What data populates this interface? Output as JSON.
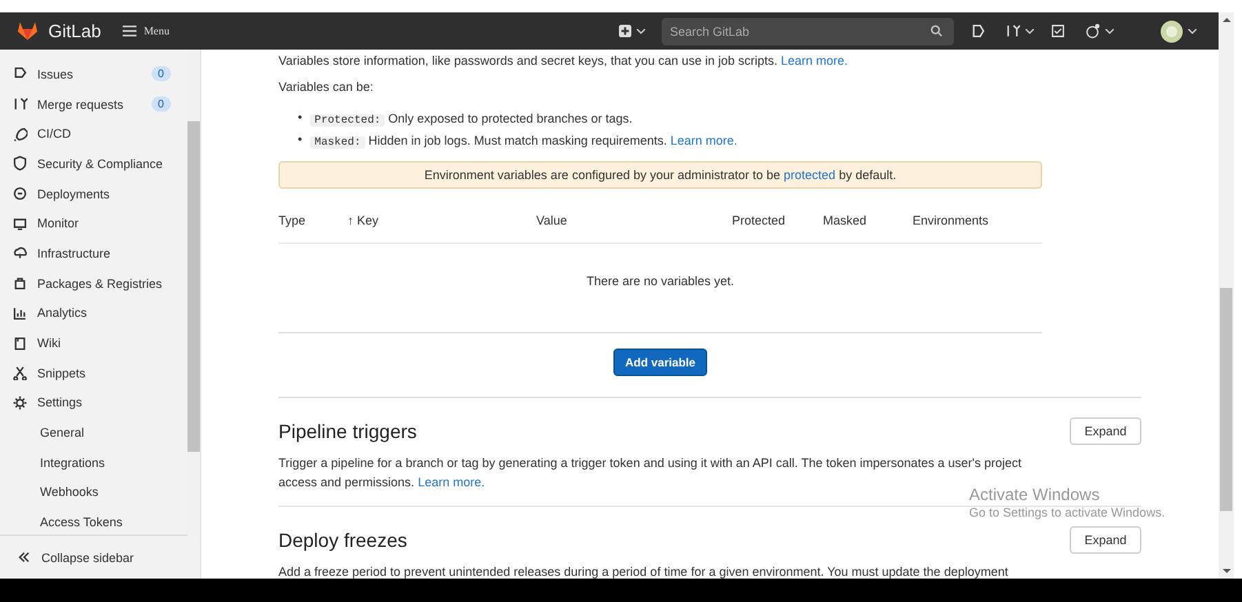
{
  "header": {
    "logo_text": "GitLab",
    "menu_label": "Menu",
    "search_placeholder": "Search GitLab"
  },
  "sidebar": {
    "items": [
      {
        "label": "Issues",
        "badge": "0"
      },
      {
        "label": "Merge requests",
        "badge": "0"
      },
      {
        "label": "CI/CD"
      },
      {
        "label": "Security & Compliance"
      },
      {
        "label": "Deployments"
      },
      {
        "label": "Monitor"
      },
      {
        "label": "Infrastructure"
      },
      {
        "label": "Packages & Registries"
      },
      {
        "label": "Analytics"
      },
      {
        "label": "Wiki"
      },
      {
        "label": "Snippets"
      },
      {
        "label": "Settings",
        "children": [
          {
            "label": "General"
          },
          {
            "label": "Integrations"
          },
          {
            "label": "Webhooks"
          },
          {
            "label": "Access Tokens"
          }
        ]
      }
    ],
    "collapse_label": "Collapse sidebar"
  },
  "main": {
    "intro": {
      "text": "Variables store information, like passwords and secret keys, that you can use in job scripts.",
      "link": "Learn more."
    },
    "can_be": "Variables can be:",
    "bullets": [
      {
        "marker": "•",
        "code": "Protected:",
        "text": "Only exposed to protected branches or tags."
      },
      {
        "marker": "•",
        "code": "Masked:",
        "text": "Hidden in job logs. Must match masking requirements.",
        "link": "Learn more."
      }
    ],
    "alert": {
      "before": "Environment variables are configured by your administrator to be",
      "link": "protected",
      "after": "by default."
    },
    "table": {
      "columns": [
        "Type",
        "↑ Key",
        "Value",
        "Protected",
        "Masked",
        "Environments"
      ],
      "empty": "There are no variables yet."
    },
    "add_button": "Add variable",
    "sections": [
      {
        "title": "Pipeline triggers",
        "description": "Trigger a pipeline for a branch or tag by generating a trigger token and using it with an API call. The token impersonates a user's project access and permissions.",
        "link": "Learn more.",
        "button": "Expand"
      },
      {
        "title": "Deploy freezes",
        "description": "Add a freeze period to prevent unintended releases during a period of time for a given environment. You must update the deployment",
        "button": "Expand"
      }
    ]
  },
  "os_notice": {
    "title": "Activate Windows",
    "subtitle": "Go to Settings to activate Windows."
  }
}
